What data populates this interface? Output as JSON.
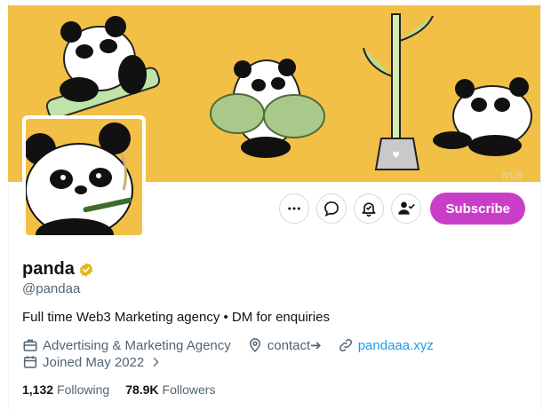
{
  "profile": {
    "name": "panda",
    "handle": "@pandaa",
    "bio": "Full time Web3 Marketing agency • DM for enquiries",
    "category": "Advertising & Marketing Agency",
    "location_link": "contact➔",
    "website": "pandaaa.xyz",
    "joined": "Joined May 2022",
    "following_count": "1,132",
    "following_label": "Following",
    "followers_count": "78.9K",
    "followers_label": "Followers"
  },
  "actions": {
    "subscribe_label": "Subscribe"
  },
  "banner": {
    "signature": "NVB"
  },
  "colors": {
    "banner_bg": "#f2c046",
    "subscribe_bg": "#c93ec8",
    "link": "#1d9bf0",
    "verified": "#e2b719"
  },
  "icons": [
    "more-icon",
    "message-icon",
    "notification-bell-icon",
    "follow-check-icon",
    "verified-badge-icon",
    "briefcase-icon",
    "location-icon",
    "link-icon",
    "calendar-icon",
    "chevron-right-icon"
  ]
}
